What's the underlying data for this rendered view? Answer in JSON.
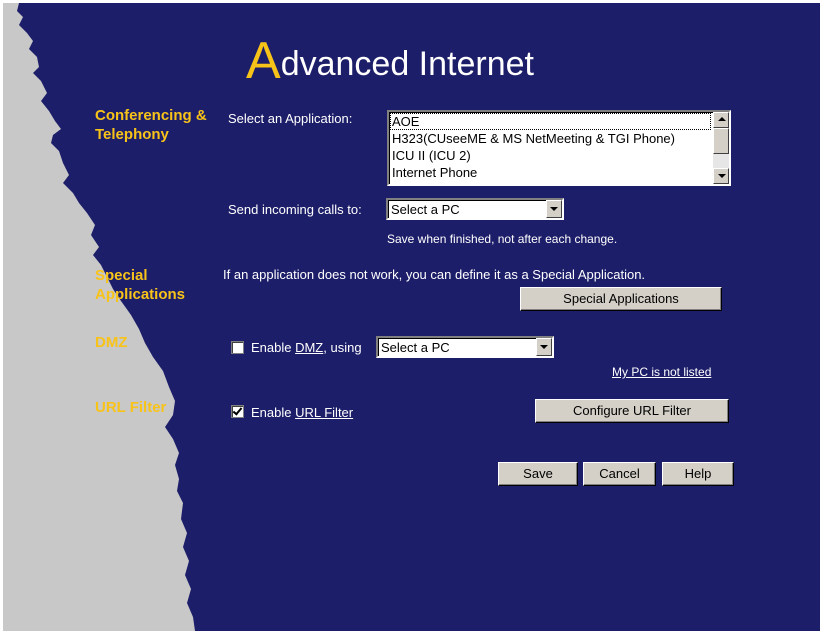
{
  "title": {
    "first_letter": "A",
    "rest": "dvanced Internet"
  },
  "sections": {
    "conferencing": "Conferencing & Telephony",
    "special": "Special Applications",
    "dmz": "DMZ",
    "url_filter": "URL Filter"
  },
  "conferencing": {
    "select_app_label": "Select an Application:",
    "applications": [
      "AOE",
      "H323(CUseeME & MS NetMeeting & TGI Phone)",
      "ICU II (ICU 2)",
      "Internet Phone"
    ],
    "send_calls_label": "Send incoming calls to:",
    "send_calls_value": "Select a PC",
    "save_hint": "Save when finished, not after each change."
  },
  "special": {
    "description": "If an application does not work, you can define it as a Special Application.",
    "button": "Special Applications"
  },
  "dmz": {
    "checked": false,
    "enable_prefix": "Enable ",
    "enable_link": "DMZ",
    "enable_suffix": ", using",
    "pc_value": "Select a PC",
    "not_listed_link": "My PC is not listed"
  },
  "url_filter": {
    "checked": true,
    "enable_prefix": "Enable ",
    "enable_link": "URL Filter",
    "configure_button": "Configure URL Filter"
  },
  "actions": {
    "save": "Save",
    "cancel": "Cancel",
    "help": "Help"
  },
  "colors": {
    "background": "#1d1e69",
    "accent": "#f8c319",
    "torn_edge": "#c8c8c8"
  }
}
